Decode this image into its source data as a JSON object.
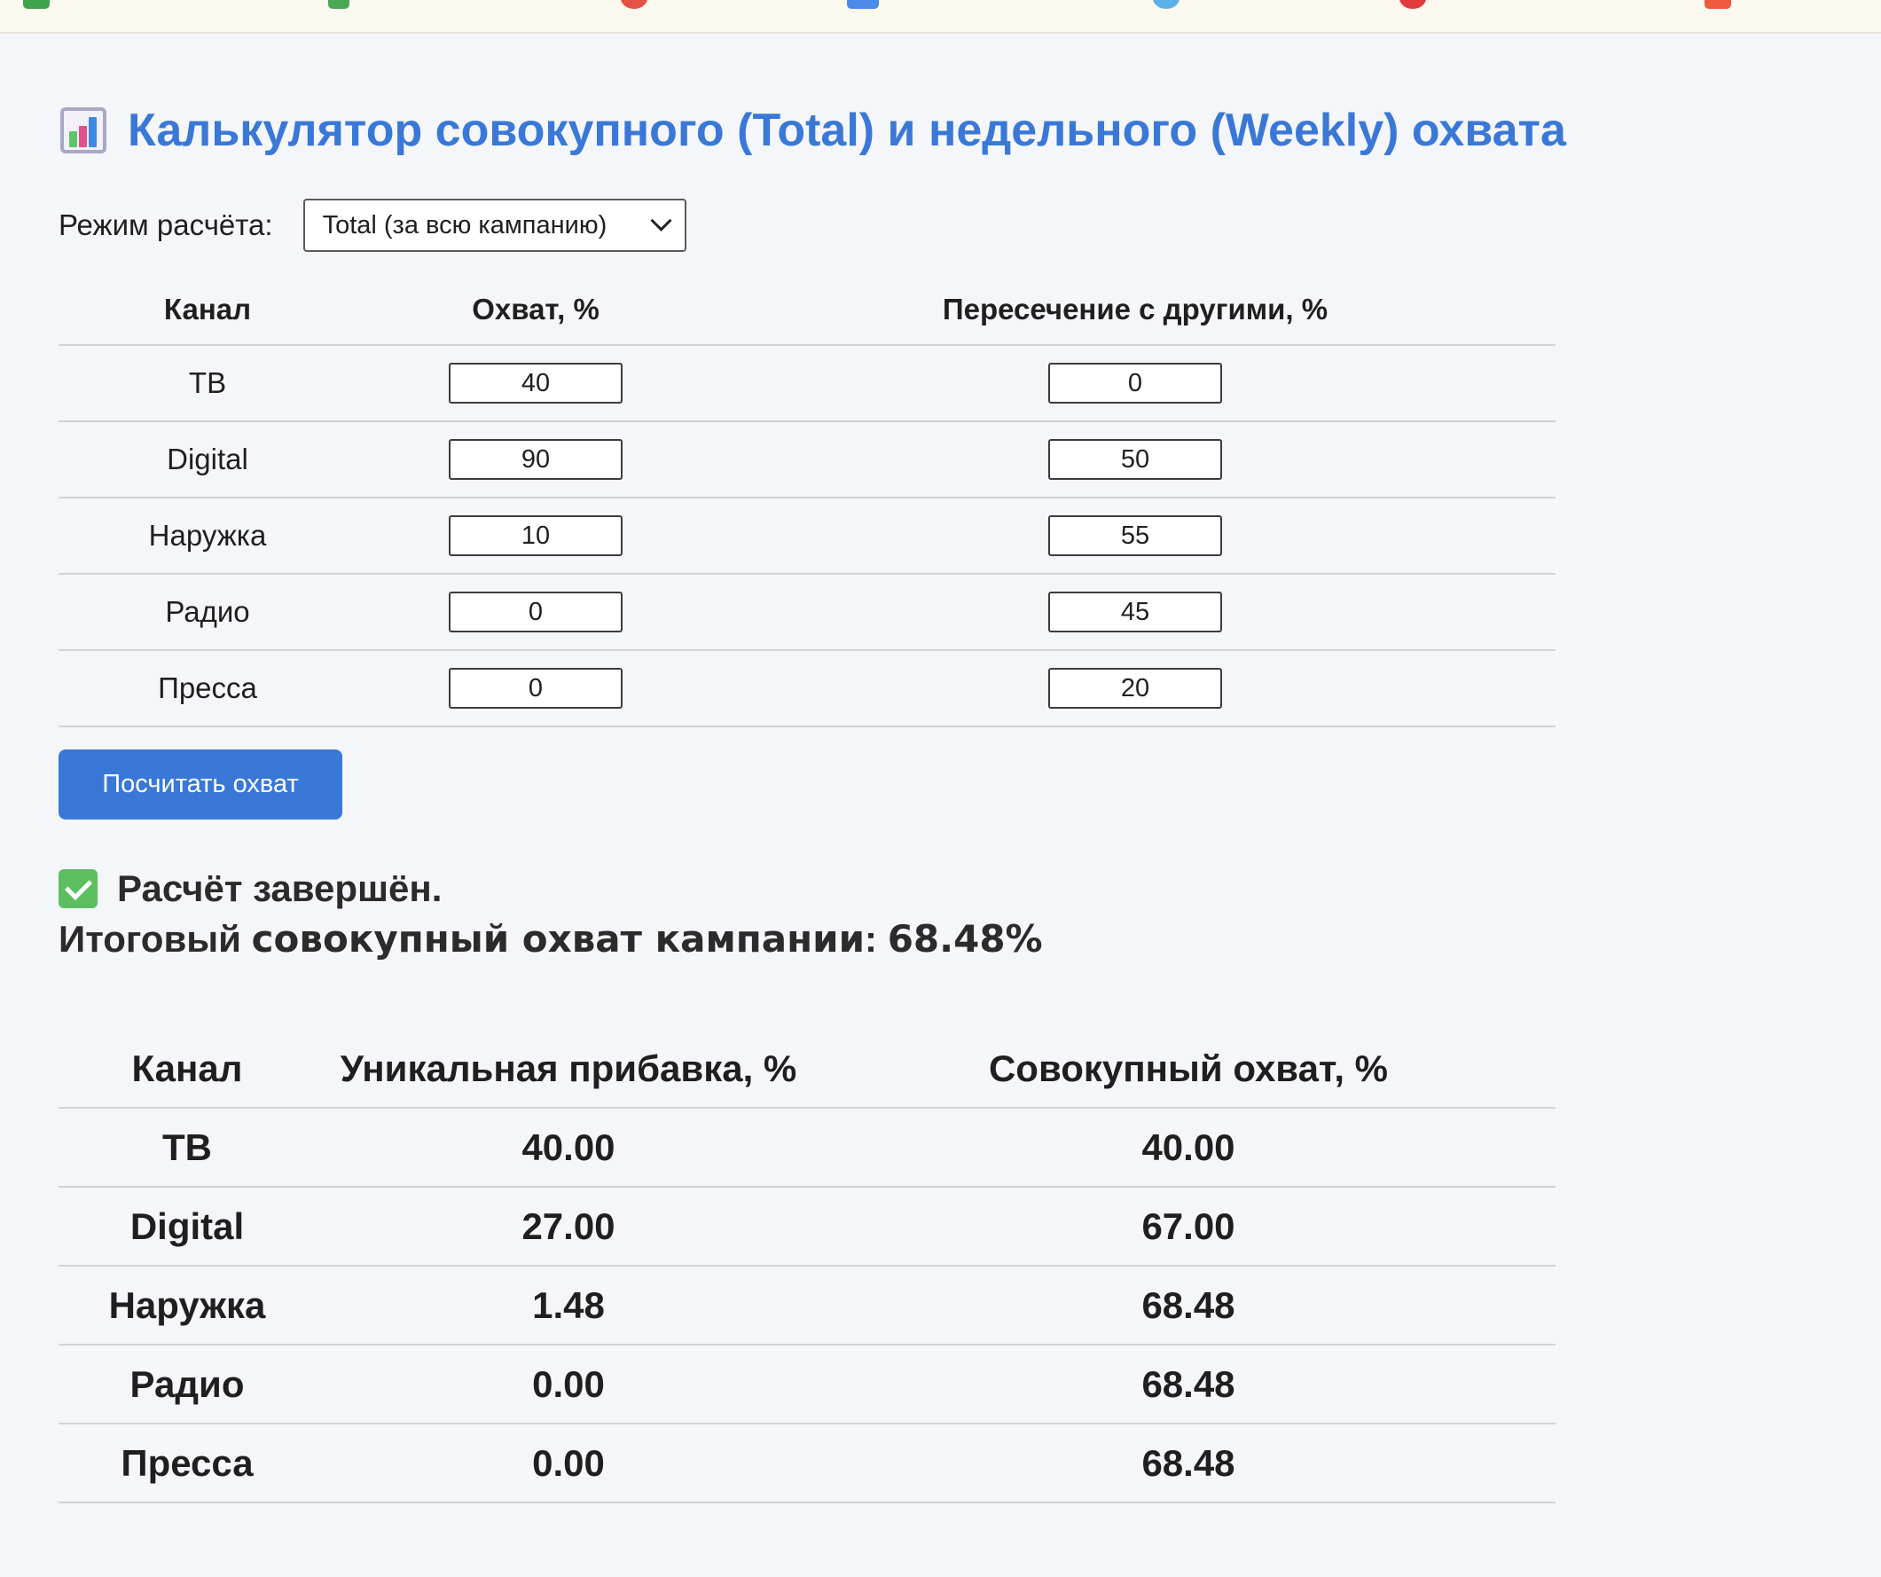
{
  "page": {
    "title": "Калькулятор совокупного (Total) и недельного (Weekly) охвата",
    "title_icon": "bar-chart-icon",
    "accent_color": "#3a78d8"
  },
  "mode": {
    "label": "Режим расчёта:",
    "selected": "Total (за всю кампанию)"
  },
  "input_table": {
    "headers": [
      "Канал",
      "Охват, %",
      "Пересечение с другими, %"
    ],
    "rows": [
      {
        "channel": "ТВ",
        "reach": "40",
        "overlap": "0"
      },
      {
        "channel": "Digital",
        "reach": "90",
        "overlap": "50"
      },
      {
        "channel": "Наружка",
        "reach": "10",
        "overlap": "55"
      },
      {
        "channel": "Радио",
        "reach": "0",
        "overlap": "45"
      },
      {
        "channel": "Пресса",
        "reach": "0",
        "overlap": "20"
      }
    ]
  },
  "calculate_button": "Посчитать охват",
  "result": {
    "status_icon": "check-mark-icon",
    "status": "Расчёт завершён.",
    "total_prefix": "Итоговый",
    "total_strong": "совокупный охват кампании",
    "total_sep": ":",
    "total_value": "68.48%"
  },
  "output_table": {
    "headers": [
      "Канал",
      "Уникальная прибавка, %",
      "Совокупный охват, %"
    ],
    "rows": [
      {
        "channel": "ТВ",
        "unique": "40.00",
        "cumulative": "40.00"
      },
      {
        "channel": "Digital",
        "unique": "27.00",
        "cumulative": "67.00"
      },
      {
        "channel": "Наружка",
        "unique": "1.48",
        "cumulative": "68.48"
      },
      {
        "channel": "Радио",
        "unique": "0.00",
        "cumulative": "68.48"
      },
      {
        "channel": "Пресса",
        "unique": "0.00",
        "cumulative": "68.48"
      }
    ]
  }
}
